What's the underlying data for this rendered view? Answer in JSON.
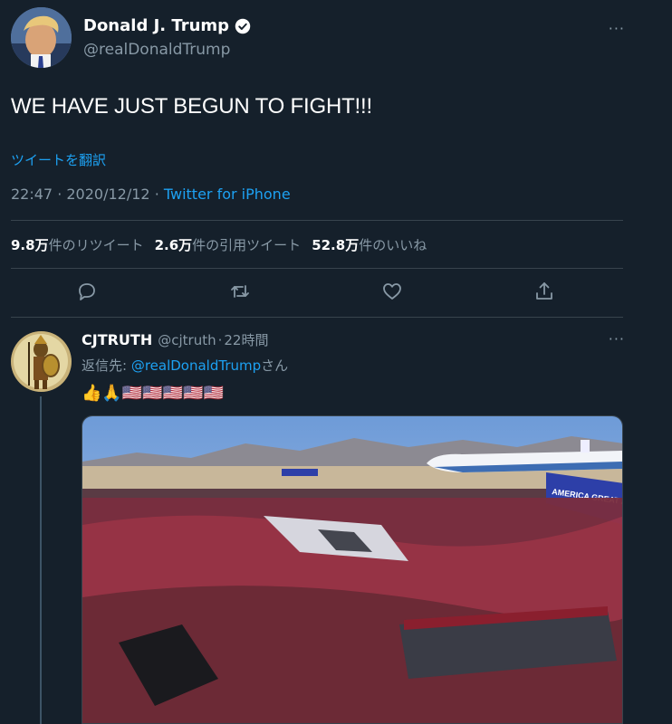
{
  "tweet": {
    "author_name": "Donald J. Trump",
    "author_handle": "@realDonaldTrump",
    "text": "WE HAVE JUST BEGUN TO FIGHT!!!",
    "translate_label": "ツイートを翻訳",
    "time": "22:47",
    "date": "2020/12/12",
    "client": "Twitter for iPhone",
    "stats": {
      "retweets_value": "9.8万",
      "retweets_label": "件のリツイート",
      "quotes_value": "2.6万",
      "quotes_label": "件の引用ツイート",
      "likes_value": "52.8万",
      "likes_label": "件のいいね"
    },
    "more_label": "···"
  },
  "reply": {
    "author_name": "CJTRUTH",
    "author_handle": "@cjtruth",
    "time_ago": "22時間",
    "reply_prefix": "返信先: ",
    "reply_mention": "@realDonaldTrump",
    "reply_suffix": "さん",
    "emoji": "👍🙏🇺🇸🇺🇸🇺🇸🇺🇸🇺🇸",
    "media_text": "AMERICA GREAT AGAIN",
    "more_label": "···"
  },
  "icons": [
    "verified-badge-icon",
    "reply-icon",
    "retweet-icon",
    "like-icon",
    "share-icon",
    "more-icon"
  ],
  "colors": {
    "background": "#15202b",
    "accent": "#1da1f2",
    "muted": "#8899a6",
    "divider": "#38444d"
  }
}
